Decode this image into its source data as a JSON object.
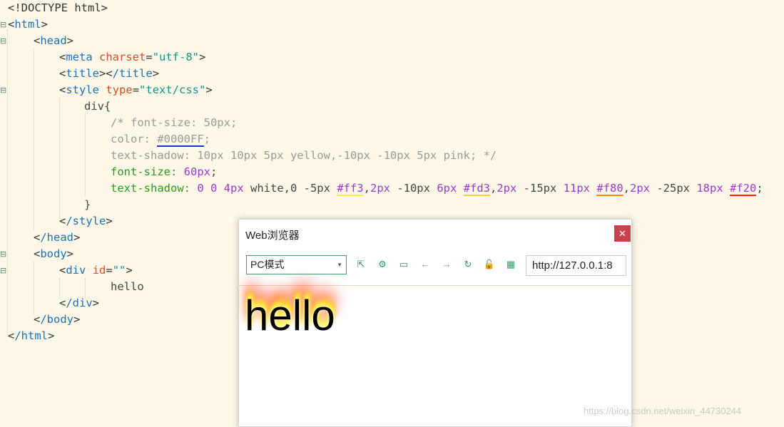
{
  "code": {
    "l1": "<!DOCTYPE html>",
    "html_open": "html",
    "head_open": "head",
    "meta_tag": "meta",
    "meta_attr": "charset",
    "meta_val": "\"utf-8\"",
    "title_open": "title",
    "title_close": "/title",
    "style_tag": "style",
    "style_attr": "type",
    "style_val": "\"text/css\"",
    "selector": "div{",
    "c1": "/* font-size: 50px;",
    "c2_prop": "color: ",
    "c2_val": "#0000FF",
    "c2_end": ";",
    "c3": "text-shadow: 10px 10px 5px yellow,-10px -10px 5px pink; */",
    "fs_prop": "font-size: ",
    "fs_val": "60px",
    "ts_prop": "text-shadow: ",
    "ts_s1": "0 0 4px",
    "ts_s2": " white,0 -5px ",
    "ts_c1": "#ff3",
    "ts_s3": ",",
    "ts_s4": "2px",
    "ts_s5": " -10px ",
    "ts_s6": "6px",
    "ts_s7": " ",
    "ts_c2": "#fd3",
    "ts_s8": ",",
    "ts_s9": "2px",
    "ts_s10": " -15px ",
    "ts_s11": "11px",
    "ts_s12": " ",
    "ts_c3": "#f80",
    "ts_s13": ",",
    "ts_s14": "2px",
    "ts_s15": " -25px ",
    "ts_s16": "18px",
    "ts_s17": " ",
    "ts_c4": "#f20",
    "ts_end": ";",
    "brace_close": "}",
    "style_close": "/style",
    "head_close": "/head",
    "body_open": "body",
    "div_tag": "div",
    "div_attr": "id",
    "div_val": "\"\"",
    "hello": "hello",
    "div_close": "/div",
    "body_close": "/body",
    "html_close": "/html"
  },
  "browser": {
    "title": "Web浏览器",
    "close": "✕",
    "mode": "PC模式",
    "mode_arrow": "▼",
    "url": "http://127.0.0.1:8",
    "content": "hello"
  },
  "icons": {
    "open": "⇱",
    "settings": "⚙",
    "console": "▭",
    "back": "←",
    "forward": "→",
    "refresh": "↻",
    "lock": "🔓",
    "qr": "▦"
  },
  "watermark": "https://blog.csdn.net/weixin_44730244"
}
